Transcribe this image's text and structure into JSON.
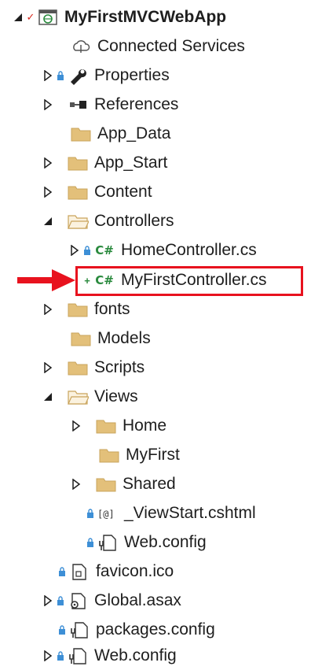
{
  "solution_explorer": {
    "project": {
      "name": "MyFirstMVCWebApp"
    },
    "items": [
      {
        "label": "Connected Services"
      },
      {
        "label": "Properties"
      },
      {
        "label": "References"
      },
      {
        "label": "App_Data"
      },
      {
        "label": "App_Start"
      },
      {
        "label": "Content"
      },
      {
        "label": "Controllers"
      },
      {
        "label": "HomeController.cs"
      },
      {
        "label": "MyFirstController.cs"
      },
      {
        "label": "fonts"
      },
      {
        "label": "Models"
      },
      {
        "label": "Scripts"
      },
      {
        "label": "Views"
      },
      {
        "label": "Home"
      },
      {
        "label": "MyFirst"
      },
      {
        "label": "Shared"
      },
      {
        "label": "_ViewStart.cshtml"
      },
      {
        "label": "Web.config"
      },
      {
        "label": "favicon.ico"
      },
      {
        "label": "Global.asax"
      },
      {
        "label": "packages.config"
      },
      {
        "label": "Web.config"
      }
    ]
  },
  "annotation": {
    "highlight_color": "#e8121e",
    "arrow_color": "#e8121e"
  },
  "colors": {
    "folder": "#e3c07a",
    "folder_dark": "#c9a45c",
    "csharp": "#2a8a3e",
    "lock": "#3d8fd6",
    "checkmark": "#d6261b"
  }
}
